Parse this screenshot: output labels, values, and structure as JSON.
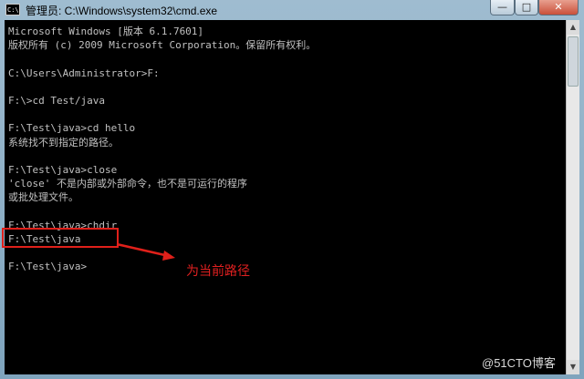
{
  "window": {
    "title": "管理员: C:\\Windows\\system32\\cmd.exe",
    "icon_text": "C:\\",
    "controls": {
      "minimize": "—",
      "maximize": "□",
      "close": "✕"
    }
  },
  "console": {
    "lines": [
      "Microsoft Windows [版本 6.1.7601]",
      "版权所有 (c) 2009 Microsoft Corporation。保留所有权利。",
      "",
      "C:\\Users\\Administrator>F:",
      "",
      "F:\\>cd Test/java",
      "",
      "F:\\Test\\java>cd hello",
      "系统找不到指定的路径。",
      "",
      "F:\\Test\\java>close",
      "'close' 不是内部或外部命令，也不是可运行的程序",
      "或批处理文件。",
      "",
      "F:\\Test\\java>chdir",
      "F:\\Test\\java",
      "",
      "F:\\Test\\java>"
    ]
  },
  "annotation": {
    "label": "为当前路径",
    "color": "#e02020"
  },
  "watermark": "@51CTO博客"
}
